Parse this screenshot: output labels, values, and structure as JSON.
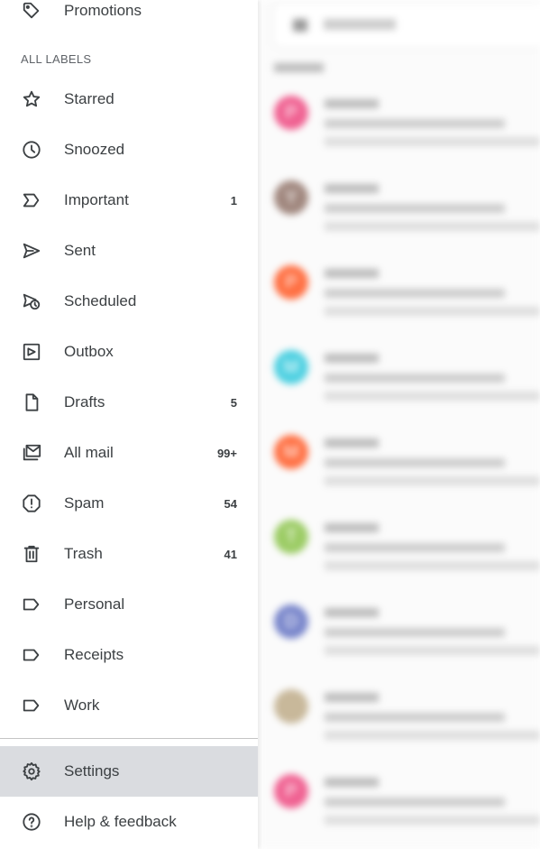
{
  "drawer": {
    "top_item": {
      "label": "Promotions",
      "icon": "tag-icon"
    },
    "section_header": "ALL LABELS",
    "items": [
      {
        "label": "Starred",
        "icon": "star-icon",
        "count": ""
      },
      {
        "label": "Snoozed",
        "icon": "clock-icon",
        "count": ""
      },
      {
        "label": "Important",
        "icon": "important-icon",
        "count": "1"
      },
      {
        "label": "Sent",
        "icon": "send-icon",
        "count": ""
      },
      {
        "label": "Scheduled",
        "icon": "scheduled-icon",
        "count": ""
      },
      {
        "label": "Outbox",
        "icon": "outbox-icon",
        "count": ""
      },
      {
        "label": "Drafts",
        "icon": "draft-icon",
        "count": "5"
      },
      {
        "label": "All mail",
        "icon": "all-mail-icon",
        "count": "99+"
      },
      {
        "label": "Spam",
        "icon": "spam-icon",
        "count": "54"
      },
      {
        "label": "Trash",
        "icon": "trash-icon",
        "count": "41"
      },
      {
        "label": "Personal",
        "icon": "label-icon",
        "count": ""
      },
      {
        "label": "Receipts",
        "icon": "label-icon",
        "count": ""
      },
      {
        "label": "Work",
        "icon": "label-icon",
        "count": ""
      }
    ],
    "footer": [
      {
        "label": "Settings",
        "icon": "gear-icon",
        "active": true
      },
      {
        "label": "Help & feedback",
        "icon": "help-icon",
        "active": false
      }
    ],
    "active_bg": "#dadce0"
  },
  "background_inbox": {
    "avatars": [
      {
        "letter": "P",
        "color": "#f06292"
      },
      {
        "letter": "Y",
        "color": "#a1887f"
      },
      {
        "letter": "P",
        "color": "#ff7043"
      },
      {
        "letter": "M",
        "color": "#4dd0e1"
      },
      {
        "letter": "M",
        "color": "#ff7043"
      },
      {
        "letter": "T",
        "color": "#9ccc65"
      },
      {
        "letter": "D",
        "color": "#7986cb"
      },
      {
        "letter": "",
        "color": "#c8b89a"
      },
      {
        "letter": "P",
        "color": "#f06292"
      }
    ]
  }
}
